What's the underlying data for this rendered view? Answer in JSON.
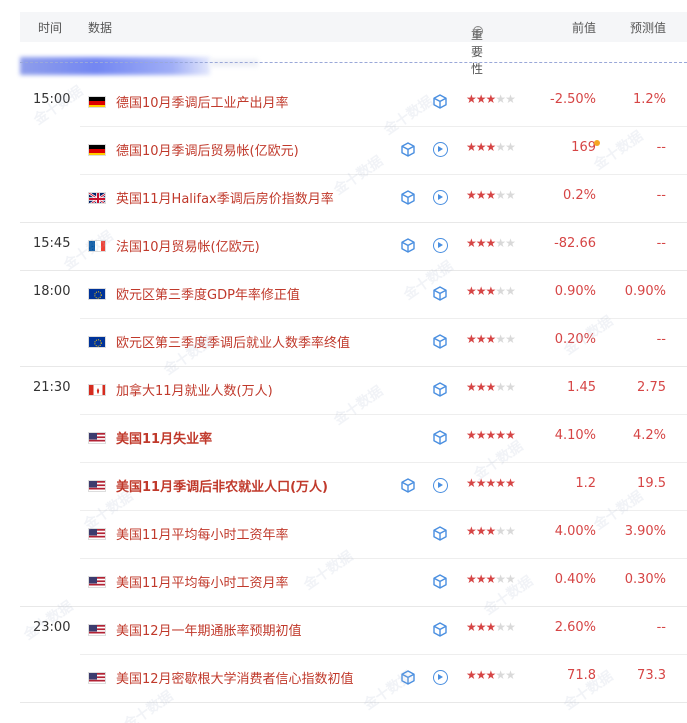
{
  "header": {
    "time": "时间",
    "data": "数据",
    "importance": "重要性",
    "info_glyph": "i",
    "previous": "前值",
    "forecast": "预测值"
  },
  "watermark": "金十数据",
  "colors": {
    "accent_red": "#d64545",
    "name_red": "#c0392b",
    "icon_blue": "#4a8fe0",
    "star_off": "#d9d9d9",
    "highlight_dot": "#f5a623"
  },
  "events": [
    {
      "time": "15:00",
      "flag": "de",
      "name": "德国10月季调后工业产出月率",
      "bold": false,
      "video": false,
      "stars": 3,
      "previous": "-2.50%",
      "forecast": "1.2%"
    },
    {
      "time": "",
      "flag": "de",
      "name": "德国10月季调后贸易帐(亿欧元)",
      "bold": false,
      "video": true,
      "stars": 3,
      "previous": "169",
      "forecast": "--",
      "previous_dot": true
    },
    {
      "time": "",
      "flag": "gb",
      "name": "英国11月Halifax季调后房价指数月率",
      "bold": false,
      "video": true,
      "stars": 3,
      "previous": "0.2%",
      "forecast": "--"
    },
    {
      "time": "15:45",
      "flag": "fr",
      "name": "法国10月贸易帐(亿欧元)",
      "bold": false,
      "video": true,
      "stars": 3,
      "previous": "-82.66",
      "forecast": "--"
    },
    {
      "time": "18:00",
      "flag": "eu",
      "name": "欧元区第三季度GDP年率修正值",
      "bold": false,
      "video": false,
      "stars": 3,
      "previous": "0.90%",
      "forecast": "0.90%"
    },
    {
      "time": "",
      "flag": "eu",
      "name": "欧元区第三季度季调后就业人数季率终值",
      "bold": false,
      "video": false,
      "stars": 3,
      "previous": "0.20%",
      "forecast": "--"
    },
    {
      "time": "21:30",
      "flag": "ca",
      "name": "加拿大11月就业人数(万人)",
      "bold": false,
      "video": false,
      "stars": 3,
      "previous": "1.45",
      "forecast": "2.75"
    },
    {
      "time": "",
      "flag": "us",
      "name": "美国11月失业率",
      "bold": true,
      "video": false,
      "stars": 5,
      "previous": "4.10%",
      "forecast": "4.2%"
    },
    {
      "time": "",
      "flag": "us",
      "name": "美国11月季调后非农就业人口(万人)",
      "bold": true,
      "video": true,
      "stars": 5,
      "previous": "1.2",
      "forecast": "19.5"
    },
    {
      "time": "",
      "flag": "us",
      "name": "美国11月平均每小时工资年率",
      "bold": false,
      "video": false,
      "stars": 3,
      "previous": "4.00%",
      "forecast": "3.90%"
    },
    {
      "time": "",
      "flag": "us",
      "name": "美国11月平均每小时工资月率",
      "bold": false,
      "video": false,
      "stars": 3,
      "previous": "0.40%",
      "forecast": "0.30%"
    },
    {
      "time": "23:00",
      "flag": "us",
      "name": "美国12月一年期通胀率预期初值",
      "bold": false,
      "video": false,
      "stars": 3,
      "previous": "2.60%",
      "forecast": "--"
    },
    {
      "time": "",
      "flag": "us",
      "name": "美国12月密歇根大学消费者信心指数初值",
      "bold": false,
      "video": true,
      "stars": 3,
      "previous": "71.8",
      "forecast": "73.3"
    }
  ]
}
